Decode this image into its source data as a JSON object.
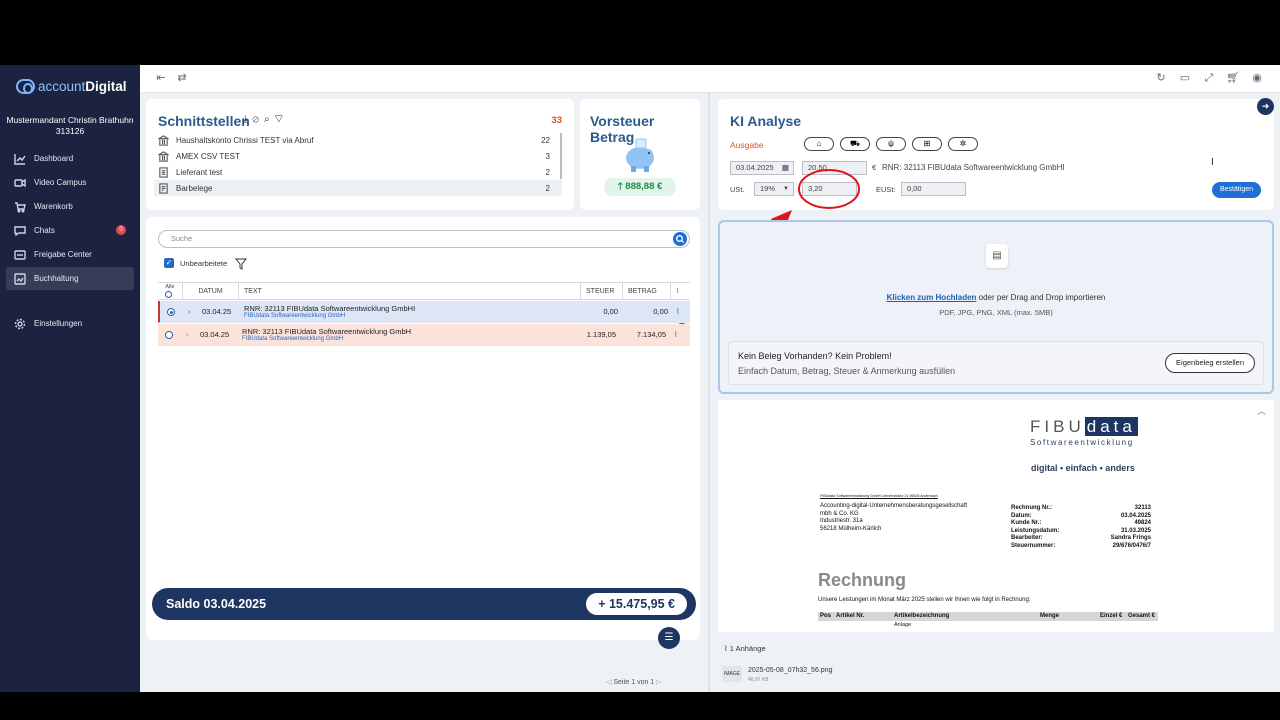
{
  "app": {
    "logo_prefix": "account",
    "logo_suffix": "Digital",
    "user_name": "Mustermandant Christin Brathuhn",
    "user_id": "313126"
  },
  "nav": [
    {
      "label": "Dashboard"
    },
    {
      "label": "Video Campus"
    },
    {
      "label": "Warenkorb"
    },
    {
      "label": "Chats",
      "badge": "0"
    },
    {
      "label": "Freigabe Center"
    },
    {
      "label": "Buchhaltung",
      "active": true
    }
  ],
  "nav_settings": "Einstellungen",
  "schnittstellen": {
    "title": "Schnittstellen",
    "count": "33",
    "rows": [
      {
        "label": "Haushaltskonto Chrissi TEST via Abruf",
        "count": "22"
      },
      {
        "label": "AMEX CSV TEST",
        "count": "3"
      },
      {
        "label": "Lieferant test",
        "count": "2"
      },
      {
        "label": "Barbelege",
        "count": "2"
      }
    ]
  },
  "vorsteuer": {
    "title": "Vorsteuer Betrag",
    "amount": "888,88 €"
  },
  "list": {
    "search_placeholder": "Suche",
    "filter_label": "Unbearbeitete",
    "headers": {
      "alle": "Alle",
      "datum": "DATUM",
      "text": "TEXT",
      "steuer": "STEUER",
      "betrag": "BETRAG"
    },
    "rows": [
      {
        "date": "03.04.25",
        "text": "RNR: 32113 FIBUdata Softwareentwicklung GmbHI",
        "sub": "FIBUdata Softwareentwicklung GmbH",
        "steuer": "0,00",
        "betrag": "0,00"
      },
      {
        "date": "03.04.25",
        "text": "RNR: 32113 FIBUdata Softwareentwicklung GmbH",
        "sub": "FIBUdata Softwareentwicklung GmbH",
        "steuer": "1.139,05",
        "betrag": "7.134,05"
      }
    ],
    "pagination": "Seite 1 von 1"
  },
  "saldo": {
    "label": "Saldo 03.04.2025",
    "value": "+ 15.475,95 €"
  },
  "ki": {
    "title": "KI Analyse",
    "type": "Ausgabe",
    "date": "03.04.2025",
    "amount": "20,50",
    "currency": "€",
    "description": "RNR: 32113 FIBUdata Softwareentwicklung GmbHI",
    "ust_label": "USt.",
    "ust_rate": "19%",
    "ust_value": "3,20",
    "eust_label": "EUSt:",
    "eust_value": "0,00",
    "confirm": "Bestätigen"
  },
  "upload": {
    "link": "Klicken zum Hochladen",
    "text": " oder per Drag and Drop importieren",
    "formats": "PDF, JPG, PNG, XML (max. 5MB)",
    "hint_title": "Kein Beleg Vorhanden? Kein Problem!",
    "hint_text": "Einfach Datum, Betrag, Steuer & Anmerkung ausfüllen",
    "eigenbeleg": "Eigenbeleg erstellen"
  },
  "invoice": {
    "logo_left": "FIBU",
    "logo_right": "data",
    "logo_sub": "Softwareentwicklung",
    "slogan": "digital • einfach • anders",
    "sender_line": "FIBUdata Softwareentwicklung GmbH Leimenstraße 21 56626 Andernach",
    "address": [
      "Accounting-digital-Unternehmensberatungsgesellschaft",
      "mbh & Co. KG",
      "Industriestr. 31a",
      "56218 Mülheim-Kärlich"
    ],
    "meta_labels": [
      "Rechnung Nr.:",
      "Datum:",
      "Kunde Nr.:",
      "Leistungsdatum:",
      "Bearbeiter:",
      "Steuernummer:"
    ],
    "meta_values": [
      "32113",
      "03.04.2025",
      "49824",
      "31.03.2025",
      "Sandra Frings",
      "29/676/0476/7"
    ],
    "heading": "Rechnung",
    "intro": "Unsere Leistungen im Monat März 2025 stellen wir Ihnen wie folgt in Rechnung:",
    "cols": [
      "Pos",
      "Artikel Nr.",
      "Artikelbezeichnung",
      "Menge",
      "Einzel €",
      "Gesamt €"
    ],
    "first_item": "Anlage"
  },
  "attachments": {
    "label": "1 Anhänge",
    "type": "IMAGE",
    "file": "2025-05-08_07h32_56.png",
    "size": "46,97 KB"
  },
  "colors": {
    "sidebar": "#1c2340",
    "accent": "#1f6fd4",
    "ausgabe": "#d9542b",
    "annotation": "#e0121b"
  }
}
